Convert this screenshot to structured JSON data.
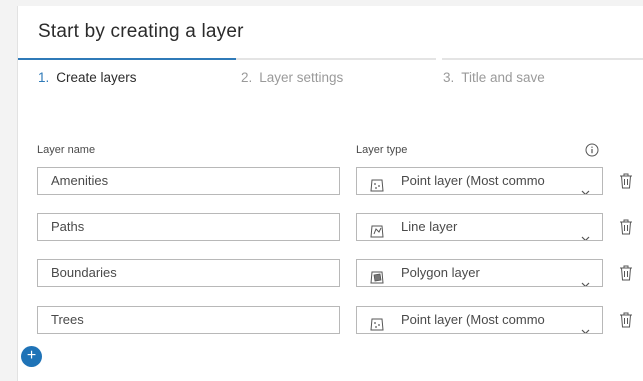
{
  "dialog": {
    "title": "Start by creating a layer"
  },
  "steps": [
    {
      "num": "1.",
      "label": "Create layers",
      "state": "active"
    },
    {
      "num": "2.",
      "label": "Layer settings",
      "state": "inactive"
    },
    {
      "num": "3.",
      "label": "Title and save",
      "state": "inactive"
    }
  ],
  "columns": {
    "name_label": "Layer name",
    "type_label": "Layer type",
    "info_icon": "info-circle-icon"
  },
  "layers": [
    {
      "name": "Amenities",
      "type": "Point layer (Most commo",
      "type_icon": "point-layer-icon"
    },
    {
      "name": "Paths",
      "type": "Line layer",
      "type_icon": "line-layer-icon"
    },
    {
      "name": "Boundaries",
      "type": "Polygon layer",
      "type_icon": "polygon-layer-icon"
    },
    {
      "name": "Trees",
      "type": "Point layer (Most commo",
      "type_icon": "point-layer-icon"
    }
  ],
  "add_button": {
    "label": "+",
    "icon": "plus-icon"
  },
  "colors": {
    "accent": "#2f7ab8",
    "button": "#1f73b7",
    "inactive_step": "#9a9a9a",
    "border": "#b8b8b8"
  }
}
